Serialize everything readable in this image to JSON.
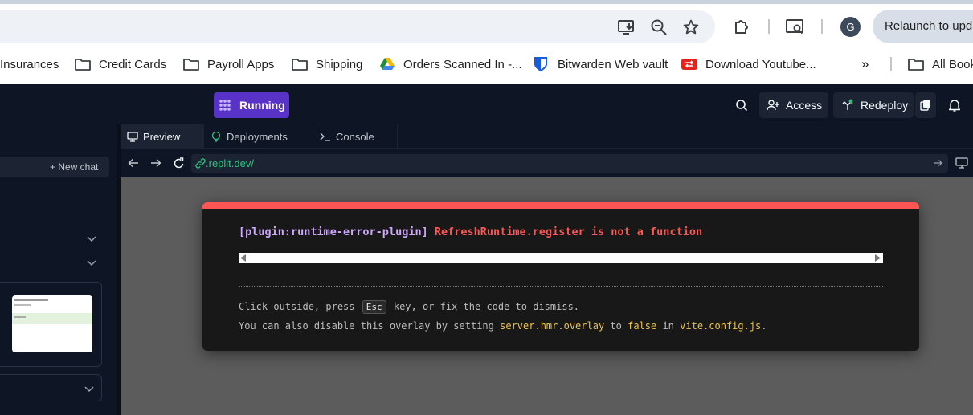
{
  "browser": {
    "relaunch_label": "Relaunch to update",
    "profile_initial": "G",
    "bookmarks": [
      {
        "label": "Insurances",
        "icon": "folder-icon"
      },
      {
        "label": "Credit Cards",
        "icon": "folder-icon"
      },
      {
        "label": "Payroll Apps",
        "icon": "folder-icon"
      },
      {
        "label": "Shipping",
        "icon": "folder-icon"
      },
      {
        "label": "Orders Scanned In -...",
        "icon": "google-drive-icon"
      },
      {
        "label": "Bitwarden Web vault",
        "icon": "bitwarden-icon"
      },
      {
        "label": "Download Youtube...",
        "icon": "youtube-download-icon"
      }
    ],
    "overflow_label": "»",
    "all_bookmarks_label": "All Bookmarks"
  },
  "replit": {
    "status_badge": "Running",
    "access_label": "Access",
    "redeploy_label": "Redeploy",
    "new_chat_label": "+ New chat",
    "tabs": [
      {
        "label": "Preview",
        "active": true
      },
      {
        "label": "Deployments",
        "active": false
      },
      {
        "label": "Console",
        "active": false
      }
    ],
    "url": ".replit.dev/",
    "accent_color": "#5932c8"
  },
  "error_overlay": {
    "plugin": "[plugin:runtime-error-plugin]",
    "message": "RefreshRuntime.register is not a function",
    "tip1_before": "Click outside, press",
    "tip1_key": "Esc",
    "tip1_after": "key, or fix the code to dismiss.",
    "tip2_part1": "You can also disable this overlay by setting",
    "tip2_code1": "server.hmr.overlay",
    "tip2_part2": "to",
    "tip2_code2": "false",
    "tip2_part3": "in",
    "tip2_code3": "vite.config.js",
    "tip2_end": ".",
    "border_color": "#ff5555"
  }
}
